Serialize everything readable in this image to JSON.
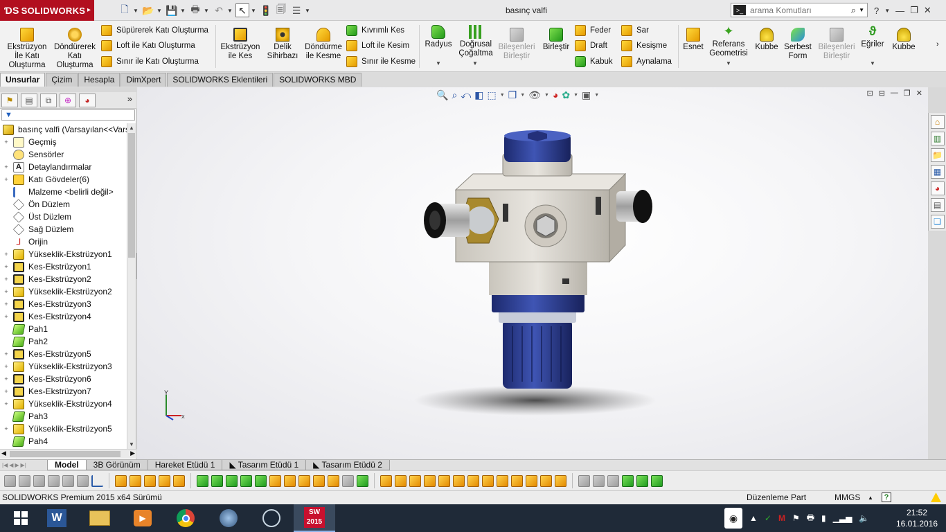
{
  "app": {
    "logo": "SOLIDWORKS",
    "document_title": "basınç valfi",
    "search_placeholder": "arama Komutları"
  },
  "ribbon": {
    "solid_group": [
      {
        "label": "Ekstrüzyon İle Katı Oluşturma",
        "lines": [
          "Ekstrüzyon",
          "İle Katı",
          "Oluşturma"
        ]
      },
      {
        "label": "Döndürerek Katı Oluşturma",
        "lines": [
          "Döndürerek",
          "Katı",
          "Oluşturma"
        ]
      }
    ],
    "solid_small": [
      "Süpürerek Katı Oluşturma",
      "Loft ile Katı Oluşturma",
      "Sınır ile Katı Oluşturma"
    ],
    "cut_group": [
      {
        "label": "Ekstrüzyon ile Kes",
        "lines": [
          "Ekstrüzyon",
          "ile Kes"
        ]
      },
      {
        "label": "Delik Sihirbazı",
        "lines": [
          "Delik",
          "Sihirbazı"
        ]
      },
      {
        "label": "Döndürme ile Kesme",
        "lines": [
          "Döndürme",
          "ile Kesme"
        ]
      }
    ],
    "cut_small": [
      "Kıvrımlı Kes",
      "Loft ile Kesim",
      "Sınır ile Kesme"
    ],
    "features": [
      {
        "label": "Radyus",
        "lines": [
          "Radyus"
        ]
      },
      {
        "label": "Doğrusal Çoğaltma",
        "lines": [
          "Doğrusal",
          "Çoğaltma"
        ]
      },
      {
        "label": "Bileşenleri Birleştir",
        "lines": [
          "Bileşenleri",
          "Birleştir"
        ],
        "disabled": true
      },
      {
        "label": "Birleştir",
        "lines": [
          "Birleştir"
        ]
      }
    ],
    "features_small_a": [
      "Feder",
      "Draft",
      "Kabuk"
    ],
    "features_small_b": [
      "Sar",
      "Kesişme",
      "Aynalama"
    ],
    "right_group": [
      {
        "label": "Esnet",
        "lines": [
          "Esnet"
        ]
      },
      {
        "label": "Referans Geometrisi",
        "lines": [
          "Referans",
          "Geometrisi"
        ]
      },
      {
        "label": "Kubbe",
        "lines": [
          "Kubbe"
        ]
      },
      {
        "label": "Serbest Form",
        "lines": [
          "Serbest",
          "Form"
        ]
      },
      {
        "label": "Bileşenleri Birleştir",
        "lines": [
          "Bileşenleri",
          "Birleştir"
        ],
        "disabled": true
      },
      {
        "label": "Eğriler",
        "lines": [
          "Eğriler"
        ]
      },
      {
        "label": "Kubbe",
        "lines": [
          "Kubbe"
        ]
      }
    ]
  },
  "command_tabs": [
    "Unsurlar",
    "Çizim",
    "Hesapla",
    "DimXpert",
    "SOLIDWORKS Eklentileri",
    "SOLIDWORKS MBD"
  ],
  "tree": {
    "root": "basınç valfi  (Varsayılan<<Vars",
    "items": [
      {
        "label": "Geçmiş",
        "icon": "hist",
        "expand": "+"
      },
      {
        "label": "Sensörler",
        "icon": "sens",
        "expand": ""
      },
      {
        "label": "Detaylandırmalar",
        "icon": "ann",
        "expand": "+"
      },
      {
        "label": "Katı Gövdeler(6)",
        "icon": "body",
        "expand": "+"
      },
      {
        "label": "Malzeme <belirli değil>",
        "icon": "mat",
        "expand": ""
      },
      {
        "label": "Ön Düzlem",
        "icon": "plane",
        "expand": ""
      },
      {
        "label": "Üst Düzlem",
        "icon": "plane",
        "expand": ""
      },
      {
        "label": "Sağ Düzlem",
        "icon": "plane",
        "expand": ""
      },
      {
        "label": "Orijin",
        "icon": "orig",
        "expand": ""
      },
      {
        "label": "Yükseklik-Ekstrüzyon1",
        "icon": "feat",
        "expand": "+"
      },
      {
        "label": "Kes-Ekstrüzyon1",
        "icon": "cut",
        "expand": "+"
      },
      {
        "label": "Kes-Ekstrüzyon2",
        "icon": "cut",
        "expand": "+"
      },
      {
        "label": "Yükseklik-Ekstrüzyon2",
        "icon": "feat",
        "expand": "+"
      },
      {
        "label": "Kes-Ekstrüzyon3",
        "icon": "cut",
        "expand": "+"
      },
      {
        "label": "Kes-Ekstrüzyon4",
        "icon": "cut",
        "expand": "+"
      },
      {
        "label": "Pah1",
        "icon": "chamf",
        "expand": ""
      },
      {
        "label": "Pah2",
        "icon": "chamf",
        "expand": ""
      },
      {
        "label": "Kes-Ekstrüzyon5",
        "icon": "cut",
        "expand": "+"
      },
      {
        "label": "Yükseklik-Ekstrüzyon3",
        "icon": "feat",
        "expand": "+"
      },
      {
        "label": "Kes-Ekstrüzyon6",
        "icon": "cut",
        "expand": "+"
      },
      {
        "label": "Kes-Ekstrüzyon7",
        "icon": "cut",
        "expand": "+"
      },
      {
        "label": "Yükseklik-Ekstrüzyon4",
        "icon": "feat",
        "expand": "+"
      },
      {
        "label": "Pah3",
        "icon": "chamf",
        "expand": ""
      },
      {
        "label": "Yükseklik-Ekstrüzyon5",
        "icon": "feat",
        "expand": "+"
      },
      {
        "label": "Pah4",
        "icon": "chamf",
        "expand": ""
      }
    ]
  },
  "model_tabs": [
    "Model",
    "3B Görünüm",
    "Hareket Etüdü 1",
    "Tasarım Etüdü 1",
    "Tasarım Etüdü 2"
  ],
  "status": {
    "version": "SOLIDWORKS Premium 2015 x64 Sürümü",
    "mode": "Düzenleme Part",
    "units": "MMGS",
    "help": "?"
  },
  "triad": {
    "y": "Y",
    "x": "X"
  },
  "taskbar": {
    "time": "21:52",
    "date": "16.01.2016",
    "sw_year": "2015",
    "sw_badge": "SW"
  },
  "colors": {
    "brand_red": "#b20f1f",
    "valve_blue": "#2b3b8f",
    "valve_body": "#dcdad5",
    "brass": "#a8892e"
  }
}
